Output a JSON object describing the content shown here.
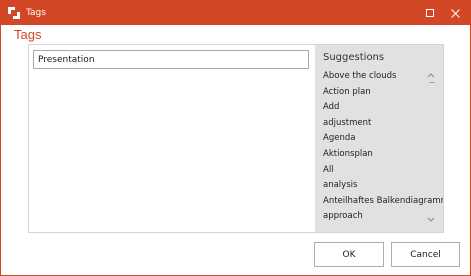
{
  "window": {
    "title": "Tags",
    "accent_color": "#d24726",
    "icons": {
      "app": "app-logo-icon",
      "maximize": "maximize-icon",
      "close": "close-icon"
    }
  },
  "dialog": {
    "heading": "Tags"
  },
  "tag_input": {
    "value": "Presentation"
  },
  "suggestions": {
    "header": "Suggestions",
    "items": [
      "Above the clouds",
      "Action plan",
      "Add",
      "adjustment",
      "Agenda",
      "Aktionsplan",
      "All",
      "analysis",
      "Anteilhaftes Balkendiagramm",
      "approach"
    ]
  },
  "buttons": {
    "ok": "OK",
    "cancel": "Cancel"
  }
}
